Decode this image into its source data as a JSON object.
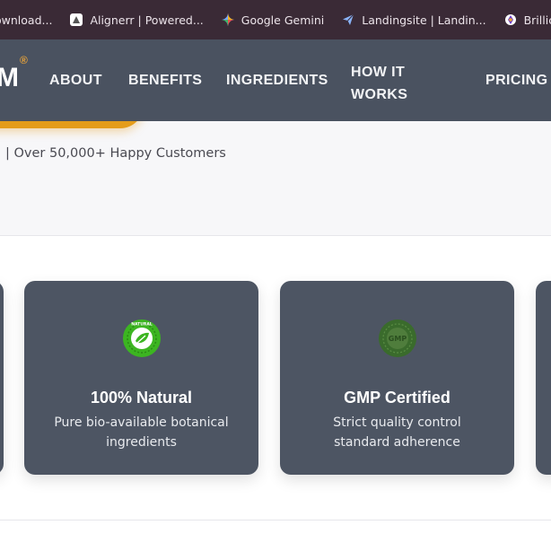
{
  "bookmarks": [
    {
      "label": "ownload...",
      "icon": "download-icon"
    },
    {
      "label": "Alignerr | Powered...",
      "icon": "alignerr-icon"
    },
    {
      "label": "Google Gemini",
      "icon": "gemini-icon"
    },
    {
      "label": "Landingsite | Landin...",
      "icon": "paper-plane-icon"
    },
    {
      "label": "Brillica Services L",
      "icon": "brillica-icon"
    }
  ],
  "header": {
    "logo_text": "M",
    "logo_mark": "®",
    "nav": [
      "ABOUT",
      "BENEFITS",
      "INGREDIENTS",
      "HOW IT WORKS",
      "PRICING"
    ]
  },
  "hero": {
    "tagline": "| Over 50,000+ Happy Customers"
  },
  "cards": [
    {
      "title": "100% Natural",
      "description": "Pure bio-available botanical ingredients",
      "icon": "natural-badge-icon",
      "badge_text": "NATURAL"
    },
    {
      "title": "GMP Certified",
      "description": "Strict quality control standard adherence",
      "icon": "gmp-badge-icon",
      "badge_text": "GMP"
    }
  ],
  "colors": {
    "bookmarks_bg": "#3a2a36",
    "header_bg": "#4a5260",
    "card_bg": "#4d5563",
    "accent_orange": "#e49c1a",
    "natural_green": "#3cb521",
    "gmp_green": "#3a6b2c"
  }
}
